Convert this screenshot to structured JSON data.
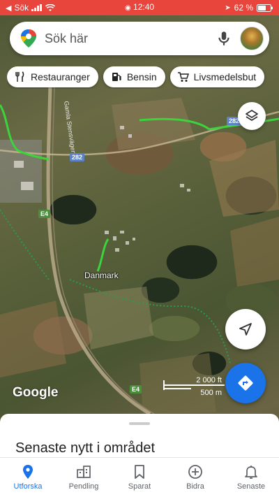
{
  "status_bar": {
    "carrier": "Sök",
    "time": "12:40",
    "battery": "62 %",
    "color": "#e8453c"
  },
  "search": {
    "placeholder": "Sök här",
    "icons": [
      "google-maps-pin-icon",
      "microphone-icon",
      "avatar"
    ]
  },
  "chips": [
    {
      "label": "Restauranger",
      "icon": "restaurant-icon"
    },
    {
      "label": "Bensin",
      "icon": "gas-station-icon"
    },
    {
      "label": "Livsmedelsbut",
      "icon": "grocery-cart-icon"
    }
  ],
  "map": {
    "place_label": "Danmark",
    "road_labels": [
      "282",
      "282",
      "E4",
      "E4"
    ],
    "street_label": "Gamla Stensvägen",
    "logo": "Google",
    "scale": {
      "imperial": "2 000 ft",
      "metric": "500 m"
    }
  },
  "buttons": {
    "layers": "layers-icon",
    "my_location": "navigation-arrow-icon",
    "directions": "directions-icon",
    "accent": "#1a73e8"
  },
  "sheet": {
    "title": "Senaste nytt i området"
  },
  "bottom_nav": [
    {
      "label": "Utforska",
      "icon": "location-pin-icon",
      "active": true
    },
    {
      "label": "Pendling",
      "icon": "commute-icon",
      "active": false
    },
    {
      "label": "Sparat",
      "icon": "bookmark-icon",
      "active": false
    },
    {
      "label": "Bidra",
      "icon": "add-circle-icon",
      "active": false
    },
    {
      "label": "Senaste",
      "icon": "bell-icon",
      "active": false
    }
  ]
}
